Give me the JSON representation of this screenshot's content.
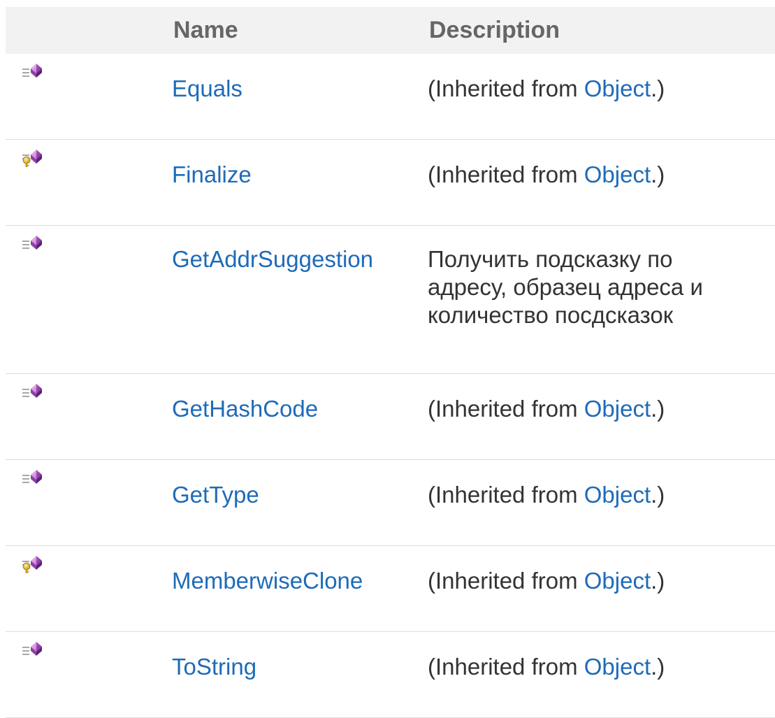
{
  "header": {
    "name_label": "Name",
    "description_label": "Description"
  },
  "colors": {
    "link": "#1e6bb8",
    "header_bg": "#f2f2f2",
    "header_text": "#666666",
    "body_text": "#333333",
    "row_border": "#dddddd"
  },
  "rows": [
    {
      "icon": "public-method-icon",
      "name": "Equals",
      "desc_prefix": "(Inherited from ",
      "desc_link": "Object",
      "desc_suffix": ".)"
    },
    {
      "icon": "protected-method-icon",
      "name": "Finalize",
      "desc_prefix": "(Inherited from ",
      "desc_link": "Object",
      "desc_suffix": ".)"
    },
    {
      "icon": "public-method-icon",
      "name": "GetAddrSuggestion",
      "description": "Получить подсказку по адресу, образец адреса и количество посдсказок"
    },
    {
      "icon": "public-method-icon",
      "name": "GetHashCode",
      "desc_prefix": "(Inherited from ",
      "desc_link": "Object",
      "desc_suffix": ".)"
    },
    {
      "icon": "public-method-icon",
      "name": "GetType",
      "desc_prefix": "(Inherited from ",
      "desc_link": "Object",
      "desc_suffix": ".)"
    },
    {
      "icon": "protected-method-icon",
      "name": "MemberwiseClone",
      "desc_prefix": "(Inherited from ",
      "desc_link": "Object",
      "desc_suffix": ".)"
    },
    {
      "icon": "public-method-icon",
      "name": "ToString",
      "desc_prefix": "(Inherited from ",
      "desc_link": "Object",
      "desc_suffix": ".)"
    }
  ]
}
